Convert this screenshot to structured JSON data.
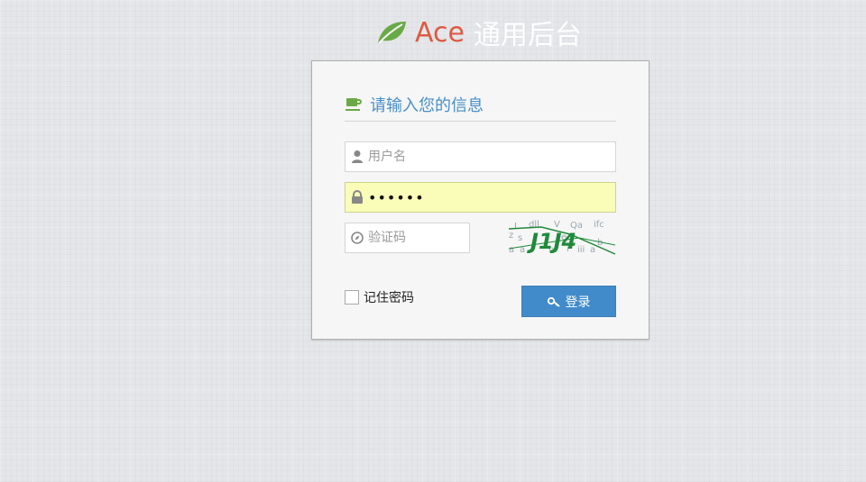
{
  "brand": {
    "logo_icon": "leaf-icon",
    "name": "Ace",
    "subtitle": "通用后台",
    "name_color": "#dd5a43",
    "leaf_color": "#69aa46"
  },
  "login": {
    "title": "请输入您的信息",
    "title_icon": "coffee-icon",
    "title_color": "#478fca",
    "username": {
      "placeholder": "用户名",
      "value": "",
      "icon": "user-icon"
    },
    "password": {
      "value": "••••••",
      "icon": "lock-icon"
    },
    "captcha": {
      "placeholder": "验证码",
      "value": "",
      "icon": "compass-icon",
      "image_text": "J1J4"
    },
    "remember_label": "记住密码",
    "remember_checked": false,
    "submit_label": "登录",
    "submit_icon": "key-icon",
    "button_color": "#428bca"
  }
}
